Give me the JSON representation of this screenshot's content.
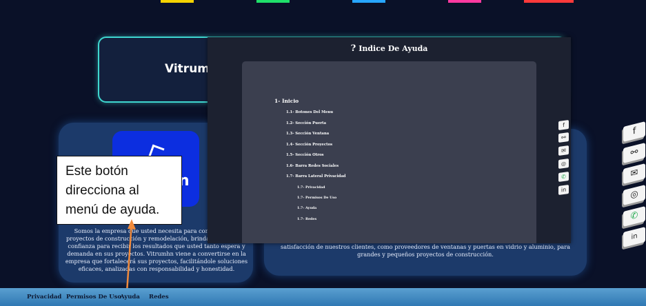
{
  "top_accent_colors": [
    "#f5d300",
    "#1fe06a",
    "#27a6ff",
    "#ff3aa0",
    "#ff3a3a"
  ],
  "hero": {
    "title": "Vitrum I"
  },
  "brand": {
    "logo_letter": "n"
  },
  "about_text": "Somos la empresa que usted necesita para completar sus proyectos de construcción y remodelación, brindándole toda la confianza para recibir los resultados que usted tanto espera y demanda en sus proyectos. Vitrumhn viene a convertirse en la empresa que fortalecerá sus proyectos, facilitándole soluciones eficaces, analizadas con responsabilidad y honestidad.",
  "mission_text": "satisfacción de nuestros clientes, como proveedores de ventanas y puertas en vidrio y aluminio, para grandes y pequeños proyectos de construcción.",
  "help_modal": {
    "title_icon": "?",
    "title": "Indice De Ayuda",
    "toc": [
      {
        "label": "1- Inicio",
        "level": 1
      },
      {
        "label": "1.1- Botones Del Menu",
        "level": 2
      },
      {
        "label": "1.2- Sección Puerta",
        "level": 2
      },
      {
        "label": "1.3- Sección Ventana",
        "level": 2
      },
      {
        "label": "1.4- Sección Proyectos",
        "level": 2
      },
      {
        "label": "1.5- Sección Otros",
        "level": 2
      },
      {
        "label": "1.6- Barra Redes Sociales",
        "level": 2
      },
      {
        "label": "1.7- Barra Lateral Privacidad",
        "level": 2
      },
      {
        "label": "1.7- Privacidad",
        "level": 3
      },
      {
        "label": "1.7- Permisos De Uso",
        "level": 3
      },
      {
        "label": "1.7- Ayuda",
        "level": 3
      },
      {
        "label": "1.7- Redes",
        "level": 3
      }
    ]
  },
  "callout": {
    "text": "Este botón direcciona al menú de ayuda."
  },
  "social_icons": [
    {
      "name": "facebook-icon",
      "glyph": "f"
    },
    {
      "name": "share-icon",
      "glyph": "⚯"
    },
    {
      "name": "email-icon",
      "glyph": "✉"
    },
    {
      "name": "instagram-icon",
      "glyph": "◎"
    },
    {
      "name": "whatsapp-icon",
      "glyph": "✆"
    },
    {
      "name": "linkedin-icon",
      "glyph": "in"
    }
  ],
  "footer": {
    "links": [
      "Privacidad",
      "Permisos De Uso",
      "Ayuda",
      "Redes"
    ]
  }
}
